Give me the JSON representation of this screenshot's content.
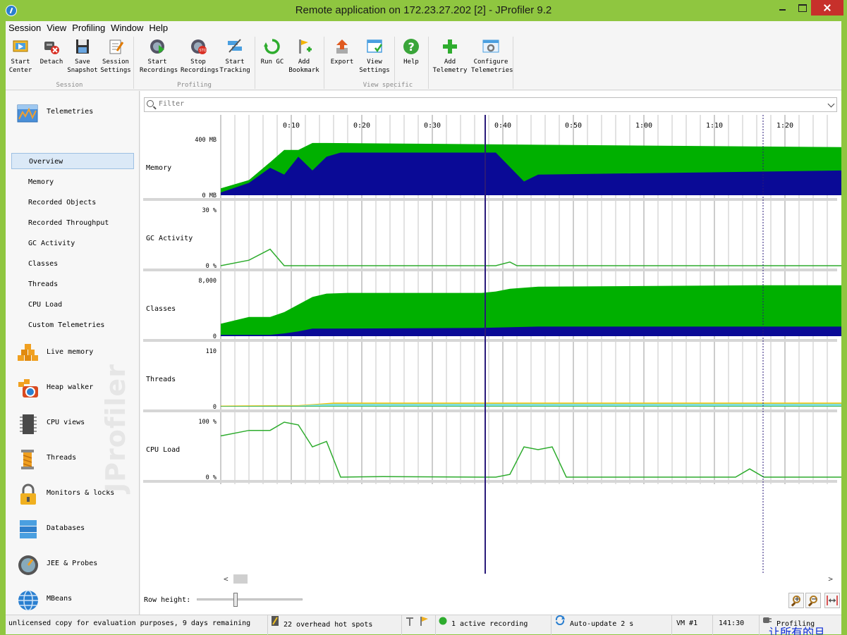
{
  "window": {
    "title": "Remote application on 172.23.27.202 [2] - JProfiler 9.2"
  },
  "menu": [
    "Session",
    "View",
    "Profiling",
    "Window",
    "Help"
  ],
  "toolbar": {
    "groups": [
      {
        "label": "Session",
        "buttons": [
          "Start\nCenter",
          "Detach",
          "Save\nSnapshot",
          "Session\nSettings"
        ]
      },
      {
        "label": "Profiling",
        "buttons": [
          "Start\nRecordings",
          "Stop\nRecordings",
          "Start\nTracking"
        ]
      },
      {
        "label": "",
        "buttons": [
          "Run GC",
          "Add\nBookmark"
        ]
      },
      {
        "label": "View specific",
        "buttons": [
          "Export",
          "View\nSettings"
        ]
      },
      {
        "label": "",
        "buttons": [
          "Help"
        ]
      },
      {
        "label": "",
        "buttons": [
          "Add\nTelemetry",
          "Configure\nTelemetries"
        ]
      }
    ]
  },
  "sidebar": {
    "telemetries": "Telemetries",
    "sub_items": [
      "Overview",
      "Memory",
      "Recorded Objects",
      "Recorded Throughput",
      "GC Activity",
      "Classes",
      "Threads",
      "CPU Load",
      "Custom Telemetries"
    ],
    "sections": [
      "Live memory",
      "Heap walker",
      "CPU views",
      "Threads",
      "Monitors & locks",
      "Databases",
      "JEE & Probes",
      "MBeans"
    ],
    "watermark": "JProfiler"
  },
  "filter": {
    "placeholder": "Filter"
  },
  "time_axis": [
    "0:10",
    "0:20",
    "0:30",
    "0:40",
    "0:50",
    "1:00",
    "1:10",
    "1:20"
  ],
  "telemetry_charts": [
    {
      "label": "Memory",
      "max_label": "400 MB",
      "min_label": "0 MB"
    },
    {
      "label": "GC Activity",
      "max_label": "30 %",
      "min_label": "0 %"
    },
    {
      "label": "Classes",
      "max_label": "8,000",
      "min_label": "0"
    },
    {
      "label": "Threads",
      "max_label": "110",
      "min_label": "0"
    },
    {
      "label": "CPU Load",
      "max_label": "100 %",
      "min_label": "0 %"
    }
  ],
  "chart_data": [
    {
      "type": "area",
      "title": "Memory",
      "x_unit": "seconds",
      "ylim": [
        0,
        400
      ],
      "y_unit": "MB",
      "series": [
        {
          "color": "#00b000",
          "x": [
            0,
            4,
            7,
            9,
            11,
            13,
            15,
            88
          ],
          "values": [
            50,
            110,
            240,
            330,
            330,
            380,
            380,
            350
          ]
        },
        {
          "color": "#0a0a96",
          "x": [
            0,
            4,
            7,
            9,
            11,
            13,
            15,
            17,
            39,
            43,
            45,
            88
          ],
          "values": [
            20,
            90,
            200,
            150,
            280,
            180,
            280,
            310,
            310,
            100,
            150,
            180
          ]
        }
      ]
    },
    {
      "type": "line",
      "title": "GC Activity",
      "x_unit": "seconds",
      "ylim": [
        0,
        30
      ],
      "y_unit": "%",
      "series": [
        {
          "color": "#2eac2e",
          "x": [
            0,
            4,
            7,
            9,
            11,
            13,
            15,
            39,
            41,
            42,
            88
          ],
          "values": [
            0,
            3,
            9,
            0,
            0,
            0,
            0,
            0,
            2,
            0,
            0
          ]
        }
      ]
    },
    {
      "type": "area",
      "title": "Classes",
      "x_unit": "seconds",
      "ylim": [
        0,
        8000
      ],
      "series": [
        {
          "color": "#00b000",
          "x": [
            0,
            4,
            7,
            9,
            11,
            13,
            15,
            18,
            37,
            39,
            41,
            45,
            76,
            88
          ],
          "values": [
            1800,
            2800,
            2800,
            3500,
            4600,
            5700,
            6200,
            6300,
            6300,
            6500,
            6900,
            7200,
            7400,
            7400
          ]
        },
        {
          "color": "#0a0a96",
          "x": [
            0,
            4,
            7,
            9,
            11,
            13,
            15,
            37,
            45,
            88
          ],
          "values": [
            200,
            200,
            200,
            400,
            700,
            1100,
            1100,
            1200,
            1400,
            1400
          ]
        }
      ]
    },
    {
      "type": "area",
      "title": "Threads",
      "x_unit": "seconds",
      "ylim": [
        0,
        110
      ],
      "series": [
        {
          "color": "#f4c400",
          "x": [
            0,
            8,
            11,
            13,
            16,
            88
          ],
          "values": [
            2,
            3,
            3,
            5,
            8,
            8
          ]
        },
        {
          "color": "#7fe0e0",
          "x": [
            0,
            8,
            11,
            13,
            16,
            88
          ],
          "values": [
            1,
            2,
            2,
            4,
            6,
            6
          ]
        },
        {
          "color": "#2eac2e",
          "x": [
            0,
            88
          ],
          "values": [
            1,
            1
          ]
        }
      ]
    },
    {
      "type": "line",
      "title": "CPU Load",
      "x_unit": "seconds",
      "ylim": [
        0,
        100
      ],
      "y_unit": "%",
      "series": [
        {
          "color": "#2eac2e",
          "x": [
            0,
            4,
            7,
            9,
            11,
            13,
            15,
            17,
            23,
            37,
            39,
            41,
            43,
            45,
            47,
            49,
            73,
            75,
            77,
            88
          ],
          "values": [
            75,
            85,
            85,
            100,
            95,
            55,
            65,
            0,
            1,
            0,
            0,
            5,
            55,
            50,
            55,
            0,
            0,
            15,
            0,
            0
          ]
        }
      ]
    }
  ],
  "markers": {
    "solid_time": "0:37.5",
    "dashed_time": "1:16.9"
  },
  "bottom": {
    "row_height_label": "Row height:"
  },
  "status": {
    "license": "unlicensed copy for evaluation purposes, 9 days remaining",
    "hotspots": "22 overhead hot spots",
    "recording": "1 active recording",
    "autoupdate": "Auto-update 2 s",
    "vm": "VM #1",
    "time": "141:30",
    "mode": "Profiling"
  },
  "overlay_text": "让所有的旦"
}
